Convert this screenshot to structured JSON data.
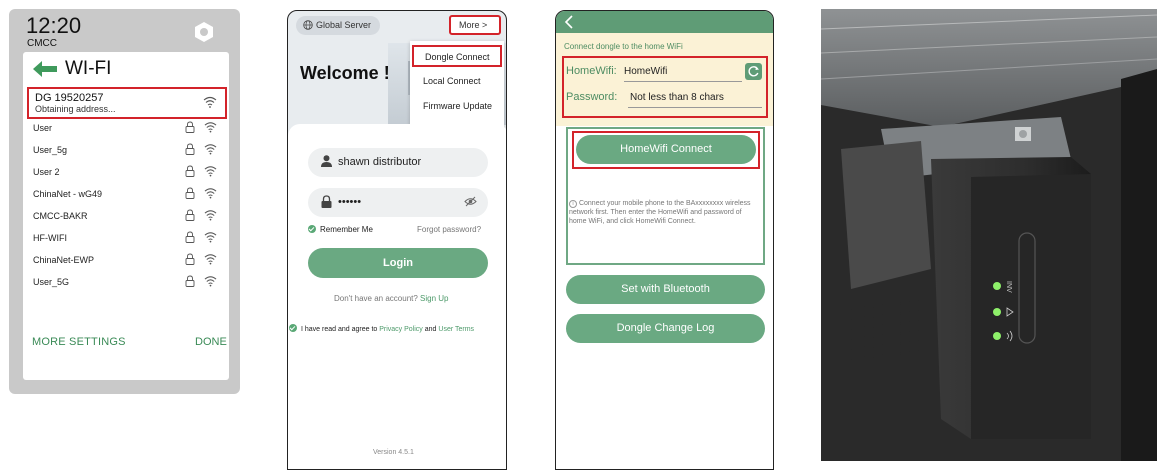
{
  "wifi_panel": {
    "clock": "12:20",
    "carrier": "CMCC",
    "title": "WI-FI",
    "current_network": {
      "name": "DG 19520257",
      "status": "Obtaining address..."
    },
    "networks": [
      {
        "name": "User"
      },
      {
        "name": "User_5g"
      },
      {
        "name": "User 2"
      },
      {
        "name": "ChinaNet - wG49"
      },
      {
        "name": "CMCC-BAKR"
      },
      {
        "name": "HF-WIFI"
      },
      {
        "name": "ChinaNet-EWP"
      },
      {
        "name": "User_5G"
      }
    ],
    "more_settings": "MORE SETTINGS",
    "done": "DONE"
  },
  "login_panel": {
    "server": "Global Server",
    "more": "More >",
    "welcome": "Welcome !",
    "menu": [
      "Dongle Connect",
      "Local Connect",
      "Firmware Update"
    ],
    "username": "shawn distributor",
    "password_mask": "••••••",
    "remember": "Remember Me",
    "forgot": "Forgot password?",
    "login": "Login",
    "no_account": "Don't have an account?",
    "sign_up": "Sign Up",
    "agree_prefix": "I have read and agree to",
    "privacy": "Privacy Policy",
    "and": "and",
    "terms": "User Terms",
    "version": "Version 4.5.1"
  },
  "dongle_panel": {
    "subtitle": "Connect dongle to the home WiFi",
    "homewifi_label": "HomeWifi:",
    "homewifi_value": "HomeWifi",
    "password_label": "Password:",
    "password_placeholder": "Not less than 8 chars",
    "connect_button": "HomeWifi Connect",
    "note": "Connect your mobile phone to the BAxxxxxxxx wireless network first. Then enter the HomeWifi and password of home WiFi, and click HomeWifi Connect.",
    "bluetooth_button": "Set with Bluetooth",
    "changelog_button": "Dongle Change Log"
  },
  "device_photo": {
    "label": "INV"
  },
  "colors": {
    "accent_green": "#6aa982",
    "highlight_red": "#d3232a"
  }
}
